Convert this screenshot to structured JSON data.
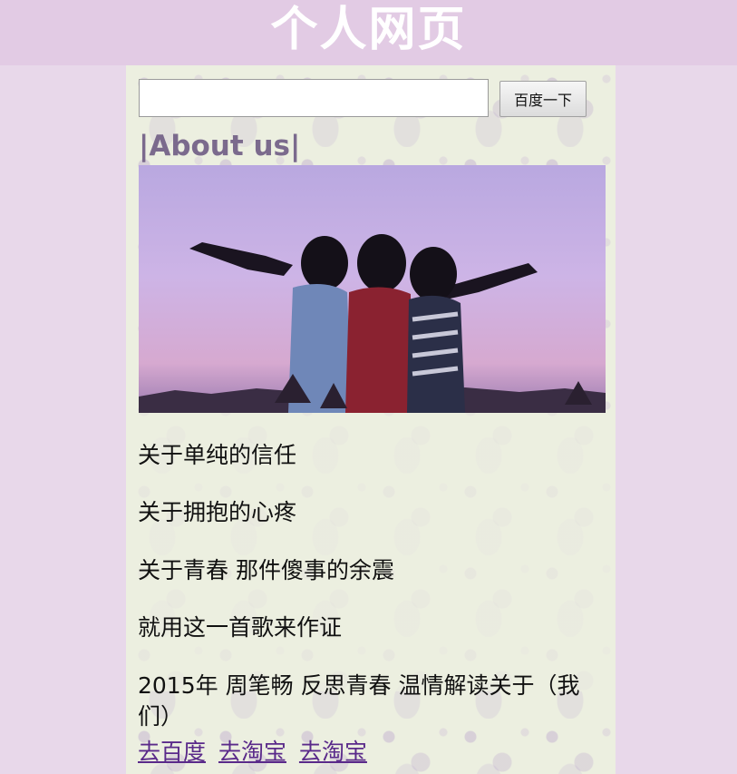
{
  "header": {
    "title": "个人网页"
  },
  "search": {
    "value": "",
    "placeholder": "",
    "button_label": "百度一下"
  },
  "about": {
    "heading": "|About us|",
    "photo_alt": ""
  },
  "lyrics": [
    "关于单纯的信任",
    "关于拥抱的心疼",
    "关于青春 那件傻事的余震",
    "就用这一首歌来作证",
    "2015年 周笔畅 反思青春 温情解读关于（我们）"
  ],
  "links": [
    {
      "label": "去百度"
    },
    {
      "label": "去淘宝"
    },
    {
      "label": "去淘宝"
    }
  ],
  "colors": {
    "page_background": "#e8d8ea",
    "header_background": "#e2cbe4",
    "heading_text": "#7b6a8d",
    "link": "#5a2a8a"
  }
}
